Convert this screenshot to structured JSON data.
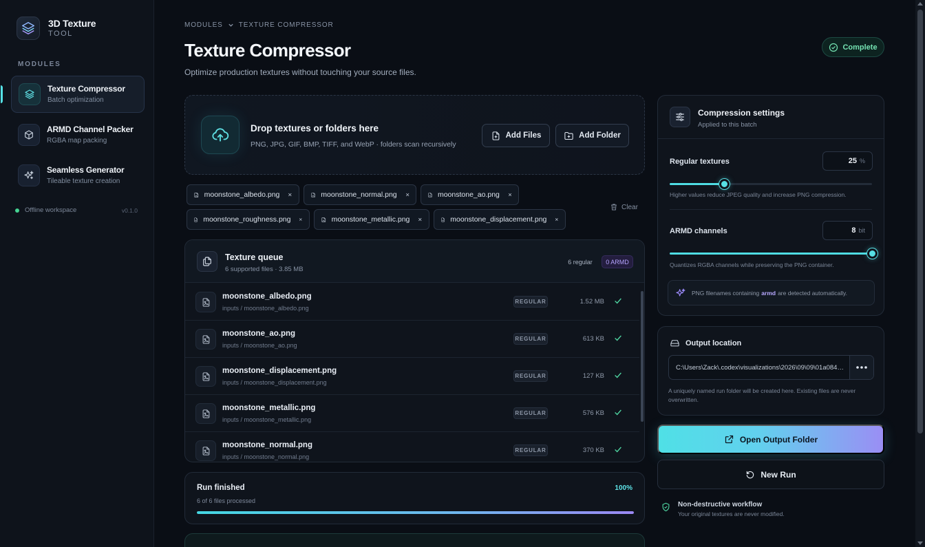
{
  "brand": {
    "title": "3D Texture",
    "subtitle": "TOOL"
  },
  "sidebar": {
    "section_label": "MODULES",
    "items": [
      {
        "title": "Texture Compressor",
        "subtitle": "Batch optimization",
        "icon": "layers-icon",
        "active": true
      },
      {
        "title": "ARMD Channel Packer",
        "subtitle": "RGBA map packing",
        "icon": "cube-icon",
        "active": false
      },
      {
        "title": "Seamless Generator",
        "subtitle": "Tileable texture creation",
        "icon": "sparkles-icon",
        "active": false
      }
    ],
    "status": "Offline workspace",
    "version": "v0.1.0"
  },
  "header": {
    "breadcrumb": [
      "MODULES",
      "TEXTURE COMPRESSOR"
    ],
    "title": "Texture Compressor",
    "subtitle": "Optimize production textures without touching your source files.",
    "status": "Complete"
  },
  "dropzone": {
    "title": "Drop textures or folders here",
    "subtitle": "PNG, JPG, GIF, BMP, TIFF, and WebP · folders scan recursively",
    "add_files": "Add Files",
    "add_folder": "Add Folder"
  },
  "chips": [
    "moonstone_albedo.png",
    "moonstone_normal.png",
    "moonstone_ao.png",
    "moonstone_roughness.png",
    "moonstone_metallic.png",
    "moonstone_displacement.png"
  ],
  "clear_label": "Clear",
  "queue": {
    "title": "Texture queue",
    "subtitle": "6 supported files · 3.85 MB",
    "regular_badge": "6 regular",
    "armd_badge": "0 ARMD",
    "rows": [
      {
        "name": "moonstone_albedo.png",
        "path": "inputs / moonstone_albedo.png",
        "type": "REGULAR",
        "size": "1.52 MB"
      },
      {
        "name": "moonstone_ao.png",
        "path": "inputs / moonstone_ao.png",
        "type": "REGULAR",
        "size": "613 KB"
      },
      {
        "name": "moonstone_displacement.png",
        "path": "inputs / moonstone_displacement.png",
        "type": "REGULAR",
        "size": "127 KB"
      },
      {
        "name": "moonstone_metallic.png",
        "path": "inputs / moonstone_metallic.png",
        "type": "REGULAR",
        "size": "576 KB"
      },
      {
        "name": "moonstone_normal.png",
        "path": "inputs / moonstone_normal.png",
        "type": "REGULAR",
        "size": "370 KB"
      }
    ]
  },
  "run": {
    "title": "Run finished",
    "subtitle": "6 of 6 files processed",
    "percent_label": "100%",
    "progress": 1.0
  },
  "settings": {
    "title": "Compression settings",
    "subtitle": "Applied to this batch",
    "regular": {
      "label": "Regular textures",
      "value": "25",
      "unit": "%",
      "fraction": 0.27,
      "help": "Higher values reduce JPEG quality and increase PNG compression."
    },
    "armd": {
      "label": "ARMD channels",
      "value": "8",
      "unit": "bit",
      "fraction": 1.0,
      "help": "Quantizes RGBA channels while preserving the PNG container."
    },
    "note_before": "PNG filenames containing",
    "note_keyword": "armd",
    "note_after": "are detected automatically."
  },
  "output": {
    "title": "Output location",
    "path": "C:\\Users\\Zack\\.codex\\visualizations\\2026\\09\\09\\01a08415-...",
    "help": "A uniquely named run folder will be created here. Existing files are never overwritten."
  },
  "actions": {
    "open_output": "Open Output Folder",
    "new_run": "New Run"
  },
  "footer_note": {
    "title": "Non-destructive workflow",
    "subtitle": "Your original textures are never modified."
  },
  "colors": {
    "accent": "#55e1e6",
    "accent_purple": "#9a8ef4",
    "success": "#74e3b2",
    "background": "#0a0e15"
  }
}
